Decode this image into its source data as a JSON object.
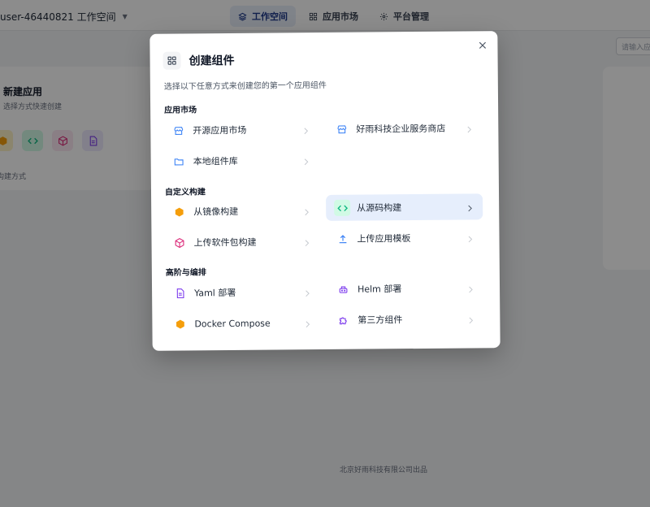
{
  "topbar": {
    "workspace": "user-46440821 工作空间",
    "tabs": [
      {
        "label": "工作空间",
        "active": true,
        "icon": "layers-icon"
      },
      {
        "label": "应用市场",
        "active": false,
        "icon": "grid-icon"
      },
      {
        "label": "平台管理",
        "active": false,
        "icon": "gear-icon"
      }
    ]
  },
  "background": {
    "search_placeholder": "请输入应用名称",
    "new_card": {
      "title": "新建应用",
      "subtitle": "选择方式快速创建",
      "footer": "构建方式"
    },
    "footer": "北京好雨科技有限公司出品"
  },
  "modal": {
    "title": "创建组件",
    "description": "选择以下任意方式来创建您的第一个应用组件",
    "sections": [
      {
        "label": "应用市场",
        "options": [
          {
            "label": "开源应用市场",
            "icon": "store-icon",
            "selected": false
          },
          {
            "label": "好雨科技企业服务商店",
            "icon": "store-icon",
            "selected": false
          },
          {
            "label": "本地组件库",
            "icon": "folder-icon",
            "selected": false
          }
        ]
      },
      {
        "label": "自定义构建",
        "options": [
          {
            "label": "从镜像构建",
            "icon": "box-icon",
            "selected": false
          },
          {
            "label": "从源码构建",
            "icon": "code-icon",
            "selected": true
          },
          {
            "label": "上传软件包构建",
            "icon": "package-icon",
            "selected": false
          },
          {
            "label": "上传应用模板",
            "icon": "upload-icon",
            "selected": false
          }
        ]
      },
      {
        "label": "高阶与编排",
        "options": [
          {
            "label": "Yaml 部署",
            "icon": "file-icon",
            "selected": false
          },
          {
            "label": "Helm 部署",
            "icon": "helm-icon",
            "selected": false
          },
          {
            "label": "Docker Compose",
            "icon": "box-icon",
            "selected": false
          },
          {
            "label": "第三方组件",
            "icon": "puzzle-icon",
            "selected": false
          }
        ]
      }
    ]
  },
  "colors": {
    "accent": "#1e3a8a",
    "selected_bg": "#e6eefc",
    "store_blue": "#3b82f6",
    "box_orange": "#f59e0b",
    "code_green": "#10b981",
    "package_pink": "#db2777",
    "file_purple": "#7c3aed"
  }
}
